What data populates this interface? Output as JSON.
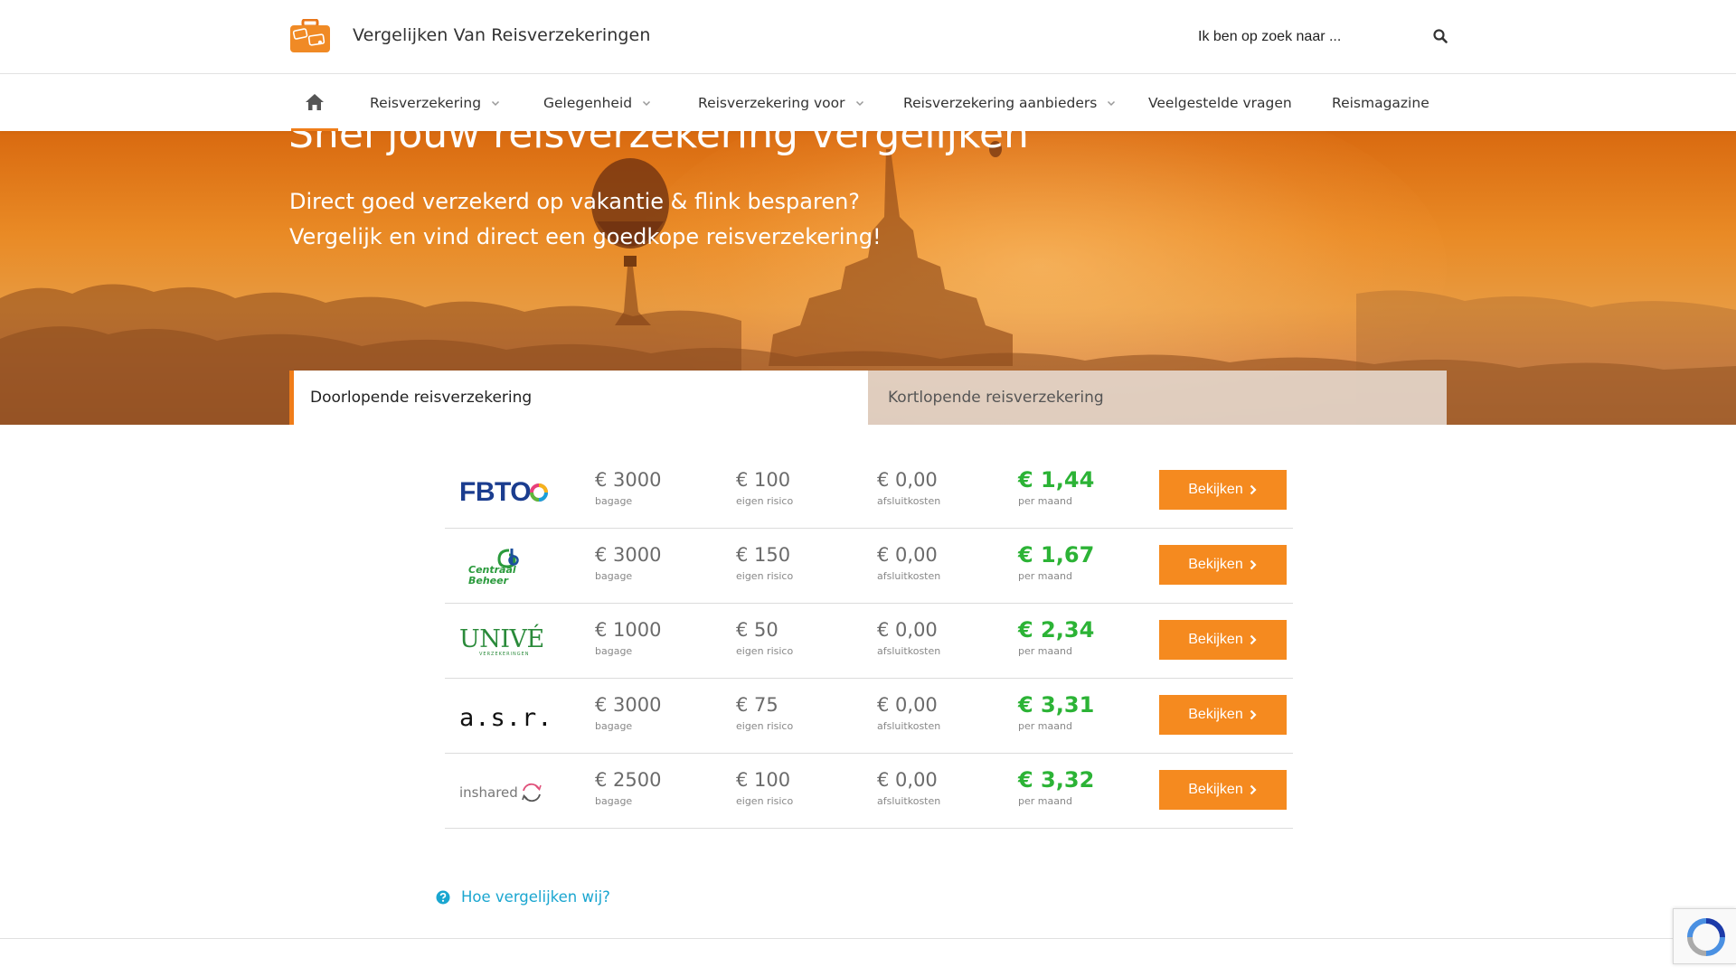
{
  "header": {
    "site_title": "Vergelijken Van Reisverzekeringen",
    "search_placeholder": "Ik ben op zoek naar ..."
  },
  "nav": {
    "items": [
      {
        "label": "Reisverzekering",
        "dropdown": true
      },
      {
        "label": "Gelegenheid",
        "dropdown": true
      },
      {
        "label": "Reisverzekering voor",
        "dropdown": true
      },
      {
        "label": "Reisverzekering aanbieders",
        "dropdown": true
      },
      {
        "label": "Veelgestelde vragen",
        "dropdown": false
      },
      {
        "label": "Reismagazine",
        "dropdown": false
      }
    ]
  },
  "hero": {
    "title": "Snel jouw reisverzekering vergelijken",
    "sub1": "Direct goed verzekerd op vakantie & flink besparen?",
    "sub2": "Vergelijk en vind direct een goedkope reisverzekering!"
  },
  "tabs": {
    "active": "Doorlopende reisverzekering",
    "inactive": "Kortlopende reisverzekering"
  },
  "labels": {
    "bagage": "bagage",
    "eigen_risico": "eigen risico",
    "afsluitkosten": "afsluitkosten",
    "per_maand": "per maand",
    "button": "Bekijken"
  },
  "rows": [
    {
      "brand": "FBTO",
      "bagage": "€ 3000",
      "eigen_risico": "€ 100",
      "afsluitkosten": "€ 0,00",
      "prijs": "€ 1,44"
    },
    {
      "brand": "Centraal Beheer",
      "bagage": "€ 3000",
      "eigen_risico": "€ 150",
      "afsluitkosten": "€ 0,00",
      "prijs": "€ 1,67"
    },
    {
      "brand": "UNIVÉ",
      "brand_sub": "VERZEKERINGEN",
      "bagage": "€ 1000",
      "eigen_risico": "€ 50",
      "afsluitkosten": "€ 0,00",
      "prijs": "€ 2,34"
    },
    {
      "brand": "a.s.r.",
      "bagage": "€ 3000",
      "eigen_risico": "€ 75",
      "afsluitkosten": "€ 0,00",
      "prijs": "€ 3,31"
    },
    {
      "brand": "inshared",
      "bagage": "€ 2500",
      "eigen_risico": "€ 100",
      "afsluitkosten": "€ 0,00",
      "prijs": "€ 3,32"
    }
  ],
  "footer": {
    "how_link": "Hoe vergelijken wij?"
  },
  "colors": {
    "accent": "#f58a1f",
    "price": "#2cb336",
    "link": "#1aa6d0"
  }
}
